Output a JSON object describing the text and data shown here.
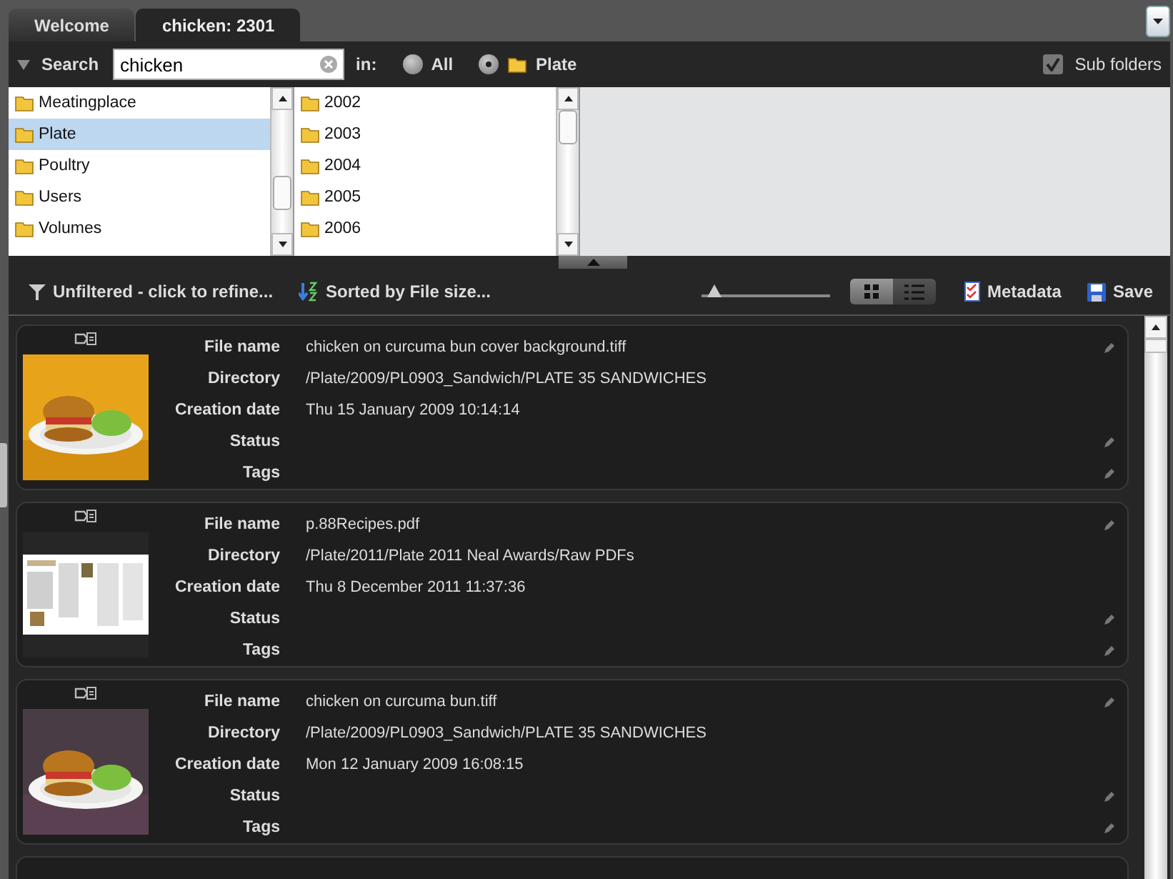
{
  "tabs": [
    {
      "label": "Welcome",
      "selected": false
    },
    {
      "label": "chicken: 2301",
      "selected": true
    }
  ],
  "search": {
    "label": "Search",
    "value": "chicken",
    "scope_label": "in:",
    "scopes": [
      {
        "label": "All",
        "selected": false,
        "folder": false
      },
      {
        "label": "Plate",
        "selected": true,
        "folder": true
      }
    ],
    "subfolders": {
      "label": "Sub folders",
      "checked": true
    }
  },
  "browser": {
    "columns": [
      {
        "items": [
          {
            "label": "Meatingplace",
            "selected": false
          },
          {
            "label": "Plate",
            "selected": true
          },
          {
            "label": "Poultry",
            "selected": false
          },
          {
            "label": "Users",
            "selected": false
          },
          {
            "label": "Volumes",
            "selected": false
          }
        ]
      },
      {
        "items": [
          {
            "label": "2002",
            "selected": false
          },
          {
            "label": "2003",
            "selected": false
          },
          {
            "label": "2004",
            "selected": false
          },
          {
            "label": "2005",
            "selected": false
          },
          {
            "label": "2006",
            "selected": false
          }
        ]
      }
    ]
  },
  "toolbar": {
    "filter": "Unfiltered - click to refine...",
    "sort": "Sorted by File size...",
    "size_slider": {
      "level": 0.1
    },
    "views": [
      {
        "kind": "grid",
        "selected": true
      },
      {
        "kind": "list",
        "selected": false
      }
    ],
    "metadata": "Metadata",
    "save": "Save"
  },
  "results": [
    {
      "fields": [
        {
          "label": "File name",
          "value": "chicken on curcuma bun cover background.tiff",
          "editable": true
        },
        {
          "label": "Directory",
          "value": "/Plate/2009/PL0903_Sandwich/PLATE 35 SANDWICHES",
          "editable": false
        },
        {
          "label": "Creation date",
          "value": "Thu 15 January 2009 10:14:14",
          "editable": false
        },
        {
          "label": "Status",
          "editable": true
        },
        {
          "label": "Tags",
          "editable": true
        }
      ]
    },
    {
      "thumbnail": {
        "kind": "document"
      },
      "fields": [
        {
          "label": "File name",
          "value": "p.88Recipes.pdf",
          "editable": true
        },
        {
          "label": "Directory",
          "value": "/Plate/2011/Plate 2011 Neal Awards/Raw PDFs",
          "editable": false
        },
        {
          "label": "Creation date",
          "value": "Thu 8 December 2011 11:37:36",
          "editable": false
        },
        {
          "label": "Status",
          "editable": true
        },
        {
          "label": "Tags",
          "editable": true
        }
      ]
    },
    {
      "fields": [
        {
          "label": "File name",
          "value": "chicken on curcuma bun.tiff",
          "editable": true
        },
        {
          "label": "Directory",
          "value": "/Plate/2009/PL0903_Sandwich/PLATE 35 SANDWICHES",
          "editable": false
        },
        {
          "label": "Creation date",
          "value": "Mon 12 January 2009 16:08:15",
          "editable": false
        },
        {
          "label": "Status",
          "editable": true
        },
        {
          "label": "Tags",
          "editable": true
        }
      ]
    }
  ]
}
